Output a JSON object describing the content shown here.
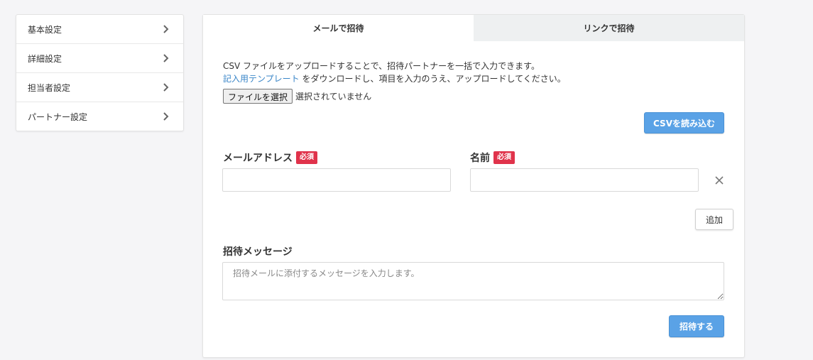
{
  "sidebar": {
    "items": [
      {
        "label": "基本設定"
      },
      {
        "label": "詳細設定"
      },
      {
        "label": "担当者設定"
      },
      {
        "label": "パートナー設定"
      }
    ]
  },
  "tabs": [
    {
      "label": "メールで招待",
      "active": true
    },
    {
      "label": "リンクで招待",
      "active": false
    }
  ],
  "csv": {
    "line1": "CSV ファイルをアップロードすることで、招待パートナーを一括で入力できます。",
    "template_link": "記入用テンプレート",
    "line2_rest": " をダウンロードし、項目を入力のうえ、アップロードしてください。",
    "file_button": "ファイルを選択",
    "file_status": "選択されていません",
    "import_button": "CSVを読み込む"
  },
  "form": {
    "email_label": "メールアドレス",
    "name_label": "名前",
    "required_badge": "必須",
    "email_value": "",
    "name_value": "",
    "add_button": "追加",
    "message_label": "招待メッセージ",
    "message_placeholder": "招待メールに添付するメッセージを入力します。",
    "invite_button": "招待する"
  },
  "colors": {
    "primary": "#5aa2e6",
    "badge": "#e0334b",
    "link": "#3a86c8"
  }
}
